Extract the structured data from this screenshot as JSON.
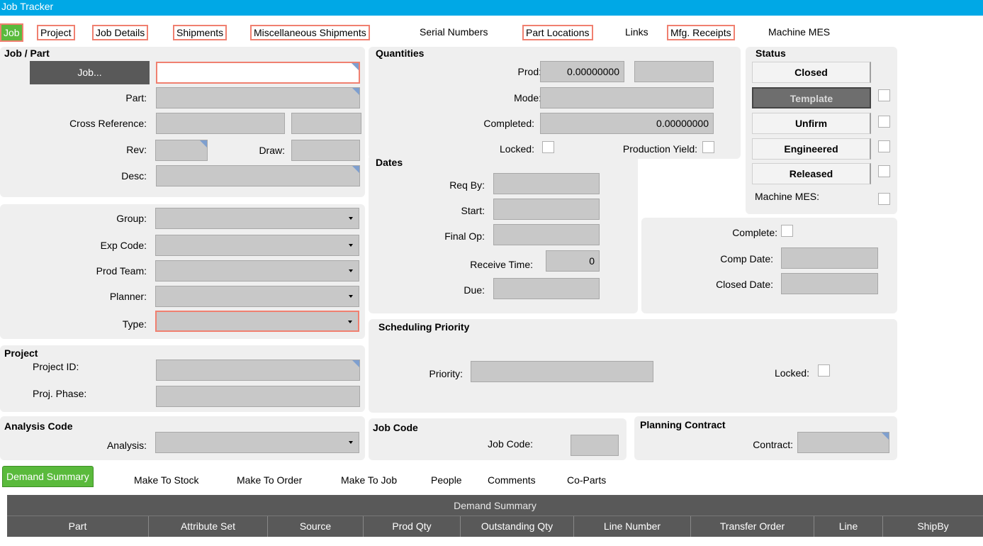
{
  "window": {
    "title": "Job Tracker"
  },
  "tabs": {
    "job": "Job",
    "project": "Project",
    "job_details": "Job Details",
    "shipments": "Shipments",
    "misc_shipments": "Miscellaneous Shipments",
    "serial_numbers": "Serial Numbers",
    "part_locations": "Part Locations",
    "links": "Links",
    "mfg_receipts": "Mfg. Receipts",
    "machine_mes": "Machine MES"
  },
  "job_part": {
    "title": "Job / Part",
    "job_button": "Job...",
    "job_value": "",
    "part_label": "Part:",
    "crossref_label": "Cross Reference:",
    "rev_label": "Rev:",
    "draw_label": "Draw:",
    "desc_label": "Desc:"
  },
  "classify": {
    "group_label": "Group:",
    "exp_code_label": "Exp Code:",
    "prod_team_label": "Prod Team:",
    "planner_label": "Planner:",
    "type_label": "Type:"
  },
  "project": {
    "title": "Project",
    "project_id_label": "Project ID:",
    "phase_label": "Proj. Phase:"
  },
  "analysis": {
    "title": "Analysis Code",
    "analysis_label": "Analysis:"
  },
  "quantities": {
    "title": "Quantities",
    "prod_label": "Prod:",
    "prod_value": "0.00000000",
    "mode_label": "Mode:",
    "completed_label": "Completed:",
    "completed_value": "0.00000000",
    "locked_label": "Locked:",
    "yield_label": "Production Yield:"
  },
  "dates": {
    "title": "Dates",
    "req_by_label": "Req By:",
    "start_label": "Start:",
    "final_op_label": "Final Op:",
    "receive_time_label": "Receive Time:",
    "receive_time_value": "0",
    "due_label": "Due:"
  },
  "status": {
    "title": "Status",
    "closed": "Closed",
    "template": "Template",
    "unfirm": "Unfirm",
    "engineered": "Engineered",
    "released": "Released",
    "machine_mes_label": "Machine MES:"
  },
  "completion": {
    "complete_label": "Complete:",
    "comp_date_label": "Comp Date:",
    "closed_date_label": "Closed Date:"
  },
  "scheduling": {
    "title": "Scheduling Priority",
    "priority_label": "Priority:",
    "locked_label": "Locked:"
  },
  "job_code": {
    "title": "Job Code",
    "label": "Job Code:"
  },
  "planning": {
    "title": "Planning Contract",
    "contract_label": "Contract:"
  },
  "bottom_tabs": {
    "demand_summary": "Demand Summary",
    "make_to_stock": "Make To Stock",
    "make_to_order": "Make To Order",
    "make_to_job": "Make To Job",
    "people": "People",
    "comments": "Comments",
    "co_parts": "Co-Parts"
  },
  "grid": {
    "title": "Demand Summary",
    "columns": [
      "Part",
      "Attribute Set",
      "Source",
      "Prod Qty",
      "Outstanding Qty",
      "Line Number",
      "Transfer Order",
      "Line",
      "ShipBy"
    ]
  }
}
